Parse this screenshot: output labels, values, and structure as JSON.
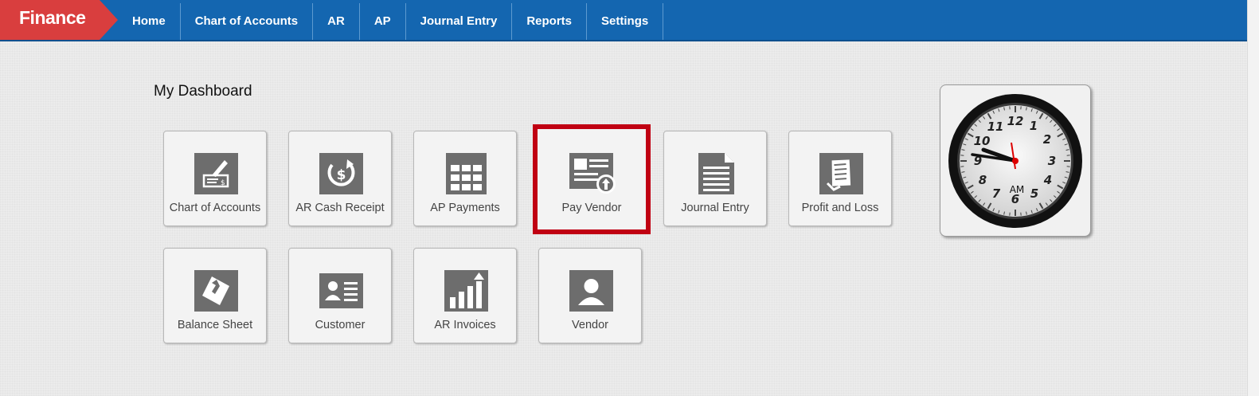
{
  "brand": "Finance",
  "nav": [
    {
      "label": "Home"
    },
    {
      "label": "Chart of Accounts"
    },
    {
      "label": "AR"
    },
    {
      "label": "AP"
    },
    {
      "label": "Journal Entry"
    },
    {
      "label": "Reports"
    },
    {
      "label": "Settings"
    }
  ],
  "dashboard": {
    "title": "My Dashboard",
    "tiles": [
      {
        "label": "Chart of Accounts",
        "icon": "check-icon"
      },
      {
        "label": "AR Cash Receipt",
        "icon": "cash-receipt-icon"
      },
      {
        "label": "AP Payments",
        "icon": "grid-icon"
      },
      {
        "label": "Pay Vendor",
        "icon": "pay-vendor-icon",
        "selected": true
      },
      {
        "label": "Journal Entry",
        "icon": "document-icon"
      },
      {
        "label": "Profit and Loss",
        "icon": "receipt-icon"
      },
      {
        "label": "Balance Sheet",
        "icon": "balance-sheet-icon"
      },
      {
        "label": "Customer",
        "icon": "customer-card-icon"
      },
      {
        "label": "AR Invoices",
        "icon": "bar-chart-icon"
      },
      {
        "label": "Vendor",
        "icon": "vendor-user-icon"
      }
    ]
  },
  "clock": {
    "period": "AM",
    "numerals": [
      "12",
      "1",
      "2",
      "3",
      "4",
      "5",
      "6",
      "7",
      "8",
      "9",
      "10",
      "11"
    ]
  },
  "colors": {
    "brand": "#d93e3e",
    "nav_bar": "#1466b0",
    "selected_border": "#c00012",
    "icon_gray": "#6d6d6d"
  }
}
